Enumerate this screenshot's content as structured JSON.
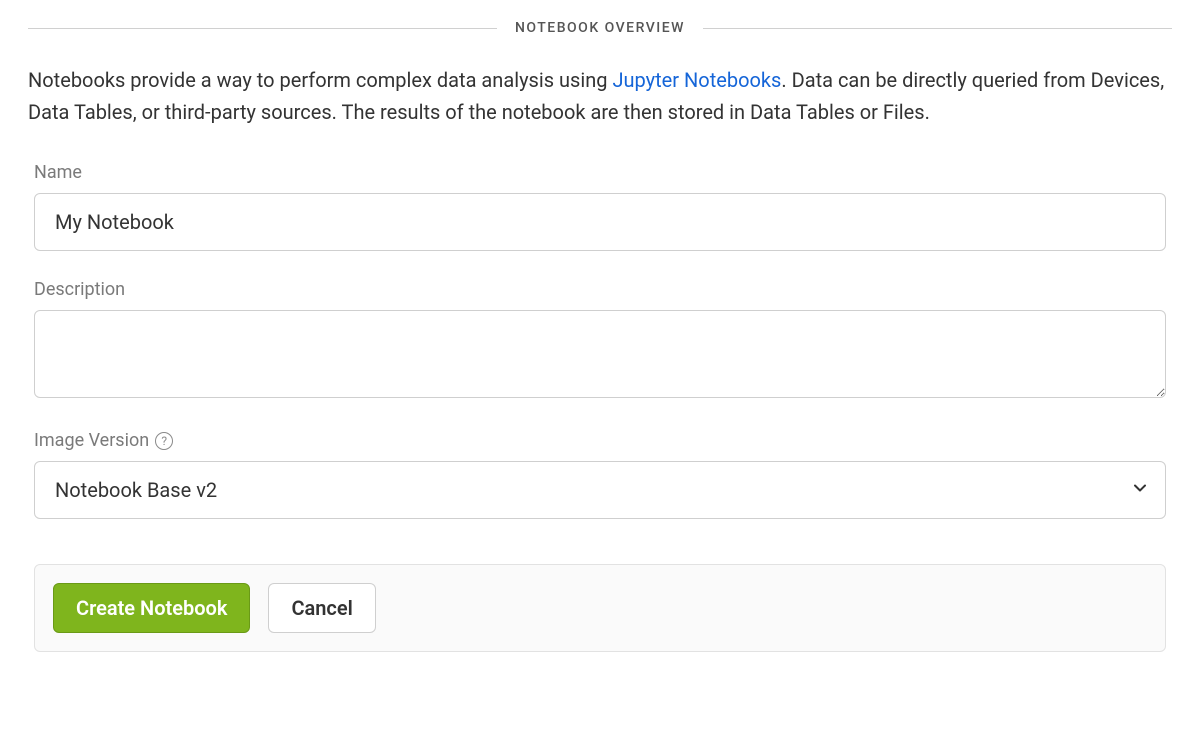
{
  "section": {
    "title": "NOTEBOOK OVERVIEW"
  },
  "intro": {
    "text_before": "Notebooks provide a way to perform complex data analysis using ",
    "link_text": "Jupyter Notebooks",
    "text_after": ". Data can be directly queried from Devices, Data Tables, or third-party sources. The results of the notebook are then stored in Data Tables or Files."
  },
  "form": {
    "name": {
      "label": "Name",
      "value": "My Notebook"
    },
    "description": {
      "label": "Description",
      "value": ""
    },
    "image_version": {
      "label": "Image Version",
      "selected": "Notebook Base v2"
    }
  },
  "actions": {
    "create": "Create Notebook",
    "cancel": "Cancel"
  }
}
